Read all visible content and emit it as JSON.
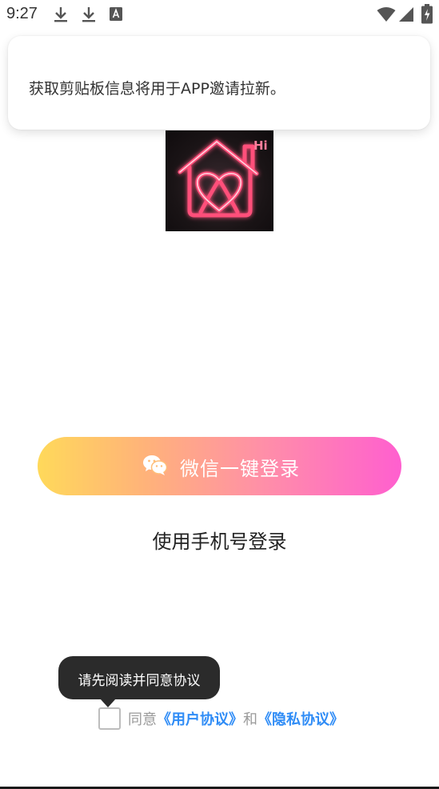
{
  "status_bar": {
    "time": "9:27",
    "left_icons": [
      "download-icon",
      "download-icon",
      "font-a-icon"
    ],
    "right_icons": [
      "wifi-icon",
      "cellular-signal-icon",
      "battery-charging-icon"
    ]
  },
  "toast": {
    "message": "获取剪贴板信息将用于APP邀请拉新。"
  },
  "logo": {
    "icon": "neon-heart-house-icon",
    "badge_text": "Hi"
  },
  "wechat_login": {
    "icon": "wechat-icon",
    "label": "微信一键登录",
    "gradient": [
      "#ffd95a",
      "#ff5fcf"
    ]
  },
  "phone_login": {
    "label": "使用手机号登录"
  },
  "tooltip": {
    "text": "请先阅读并同意协议"
  },
  "agreement": {
    "prefix": "同意",
    "user_agreement": "《用户协议》",
    "conjunction": "和",
    "privacy_policy": "《隐私协议》",
    "link_color": "#2f8cf6"
  }
}
